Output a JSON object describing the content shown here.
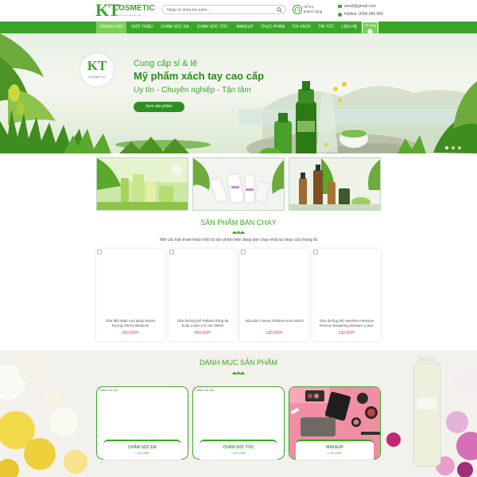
{
  "header": {
    "logo": {
      "mark": "KT",
      "name": "COSMETIC",
      "tagline": "mỹ phẩm xách tay cao cấp"
    },
    "search_placeholder": "Nhập từ khóa tìm kiếm...",
    "support": {
      "line1": "Hỗ trợ",
      "line2": "khách hàng"
    },
    "email": "email@gmail.com",
    "hotline": "Hotline: 0999.999.999"
  },
  "nav": {
    "items": [
      "TRANG CHỦ",
      "GIỚI THIỆU",
      "CHĂM SÓC DA",
      "CHĂM SÓC TÓC",
      "MAKEUP",
      "THỰC PHẨM",
      "TÚI XÁCH",
      "TIN TỨC",
      "LIÊN HỆ"
    ],
    "cart_label": "Giỏ hàng"
  },
  "hero": {
    "logo_mark": "KT",
    "logo_text": "COSMETIC",
    "line1": "Cung cấp sỉ & lẻ",
    "line2": "Mỹ phẩm xách tay cao cấp",
    "line3": "Uy tín - Chuyên nghiệp - Tận tâm",
    "button": "Xem sản phẩm"
  },
  "bestsellers": {
    "title": "SẢN PHẨM BÁN CHẠY",
    "description": "Mời các bạn tham khảo một số sản phẩm hiện đang bán chạy nhất tại shop của chúng tôi",
    "products": [
      {
        "name": "Sữa tắm Bath And Body Works hương Cherry Blossom",
        "price": "200.000₫"
      },
      {
        "name": "Sữa dưỡng thể Pelland trắng da body Lotion (có vòi) 350ml",
        "price": "450.000₫"
      },
      {
        "name": "Sữa tắm Caress Endless Kiss 532ml",
        "price": "130.000₫"
      },
      {
        "name": "Sữa dưỡng thể Vaseline Intensive Rescue Repairing Moisture Lotion",
        "price": "130.000₫"
      }
    ]
  },
  "categories": {
    "title": "DANH MỤC SẢN PHẨM",
    "items": [
      {
        "alt": "Chăm sóc da",
        "name": "CHĂM SÓC DA",
        "count": "2 sản phẩm"
      },
      {
        "alt": "Chăm sóc tóc",
        "name": "CHĂM SÓC TÓC",
        "count": "2 sản phẩm"
      },
      {
        "alt": "",
        "name": "MAKEUP",
        "count": "1 sản phẩm"
      }
    ]
  },
  "colors": {
    "primary": "#3aa629",
    "accent": "#7ccd5a",
    "price": "#e03b2b"
  }
}
